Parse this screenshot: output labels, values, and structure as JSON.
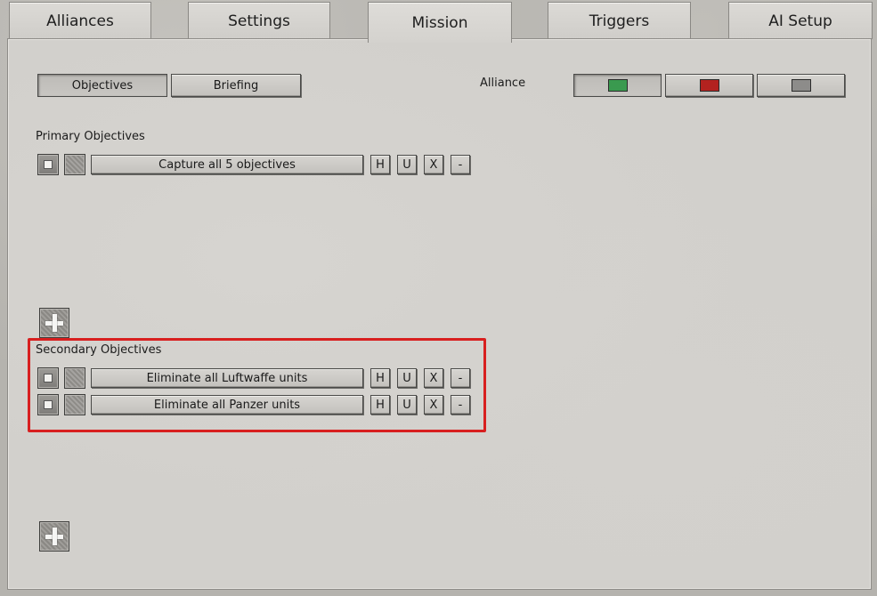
{
  "tabs": [
    {
      "label": "Alliances",
      "active": false
    },
    {
      "label": "Settings",
      "active": false
    },
    {
      "label": "Mission",
      "active": true
    },
    {
      "label": "Triggers",
      "active": false
    },
    {
      "label": "AI Setup",
      "active": false
    }
  ],
  "subtabs": {
    "objectives": "Objectives",
    "briefing": "Briefing"
  },
  "alliance": {
    "label": "Alliance",
    "colors": [
      "#3a9a4f",
      "#b3221f",
      "#8d8c8a"
    ],
    "selected": 0
  },
  "primary": {
    "title": "Primary Objectives",
    "items": [
      {
        "text": "Capture all 5 objectives"
      }
    ]
  },
  "secondary": {
    "title": "Secondary Objectives",
    "items": [
      {
        "text": "Eliminate all Luftwaffe units"
      },
      {
        "text": "Eliminate all Panzer units"
      }
    ]
  },
  "row_buttons": {
    "h": "H",
    "u": "U",
    "x": "X",
    "remove": "-"
  },
  "highlight_color": "#d81f1f"
}
